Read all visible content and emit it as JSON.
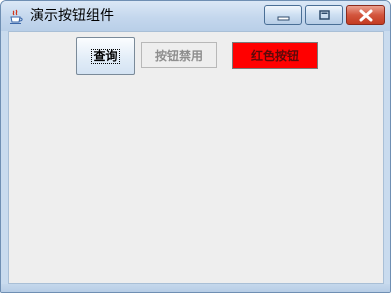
{
  "window": {
    "title": "演示按钮组件"
  },
  "buttons": {
    "query_label": "查询",
    "disabled_label": "按钮禁用",
    "red_label": "红色按钮"
  },
  "colors": {
    "red_button": "#ff0000",
    "client_background": "#eeeeee"
  },
  "icons": {
    "app": "java-coffee-cup-icon",
    "minimize": "minimize-icon",
    "maximize": "maximize-icon",
    "close": "close-icon"
  }
}
